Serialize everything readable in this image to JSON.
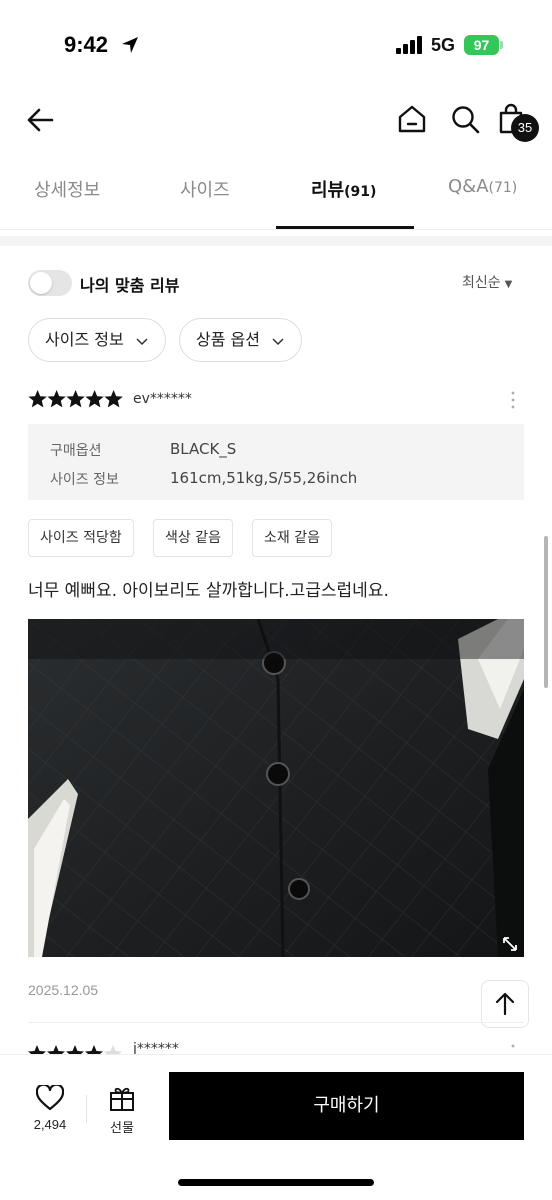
{
  "status_bar": {
    "time": "9:42",
    "network": "5G",
    "battery": "97"
  },
  "nav": {
    "cart_count": "35",
    "icons": [
      "back-arrow-icon",
      "home-icon",
      "search-icon",
      "shopping-bag-icon"
    ]
  },
  "tabs": [
    {
      "label": "상세정보",
      "count": ""
    },
    {
      "label": "사이즈",
      "count": ""
    },
    {
      "label": "리뷰",
      "count": "(91)"
    },
    {
      "label": "Q&A",
      "count": "(71)"
    }
  ],
  "filters": {
    "toggle_label": "나의 맞춤 리뷰",
    "sort_label": "최신순",
    "chips": [
      "사이즈 정보",
      "상품 옵션"
    ]
  },
  "review": {
    "rating": 5,
    "reviewer": "ev******",
    "options": [
      {
        "label": "구매옵션",
        "value": "BLACK_S"
      },
      {
        "label": "사이즈 정보",
        "value": "161cm,51kg,S/55,26inch"
      }
    ],
    "tags": [
      "사이즈 적당함",
      "색상 같음",
      "소재 같음"
    ],
    "text": "너무 예뻐요. 아이보리도 살까합니다.고급스럽네요.",
    "date": "2025.12.05"
  },
  "next_review": {
    "reviewer": "j******"
  },
  "bottom_bar": {
    "like_count": "2,494",
    "gift_label": "선물",
    "buy_label": "구매하기"
  },
  "colors": {
    "accent": "#111111",
    "battery": "#33c759",
    "muted": "#8a8a8a"
  }
}
